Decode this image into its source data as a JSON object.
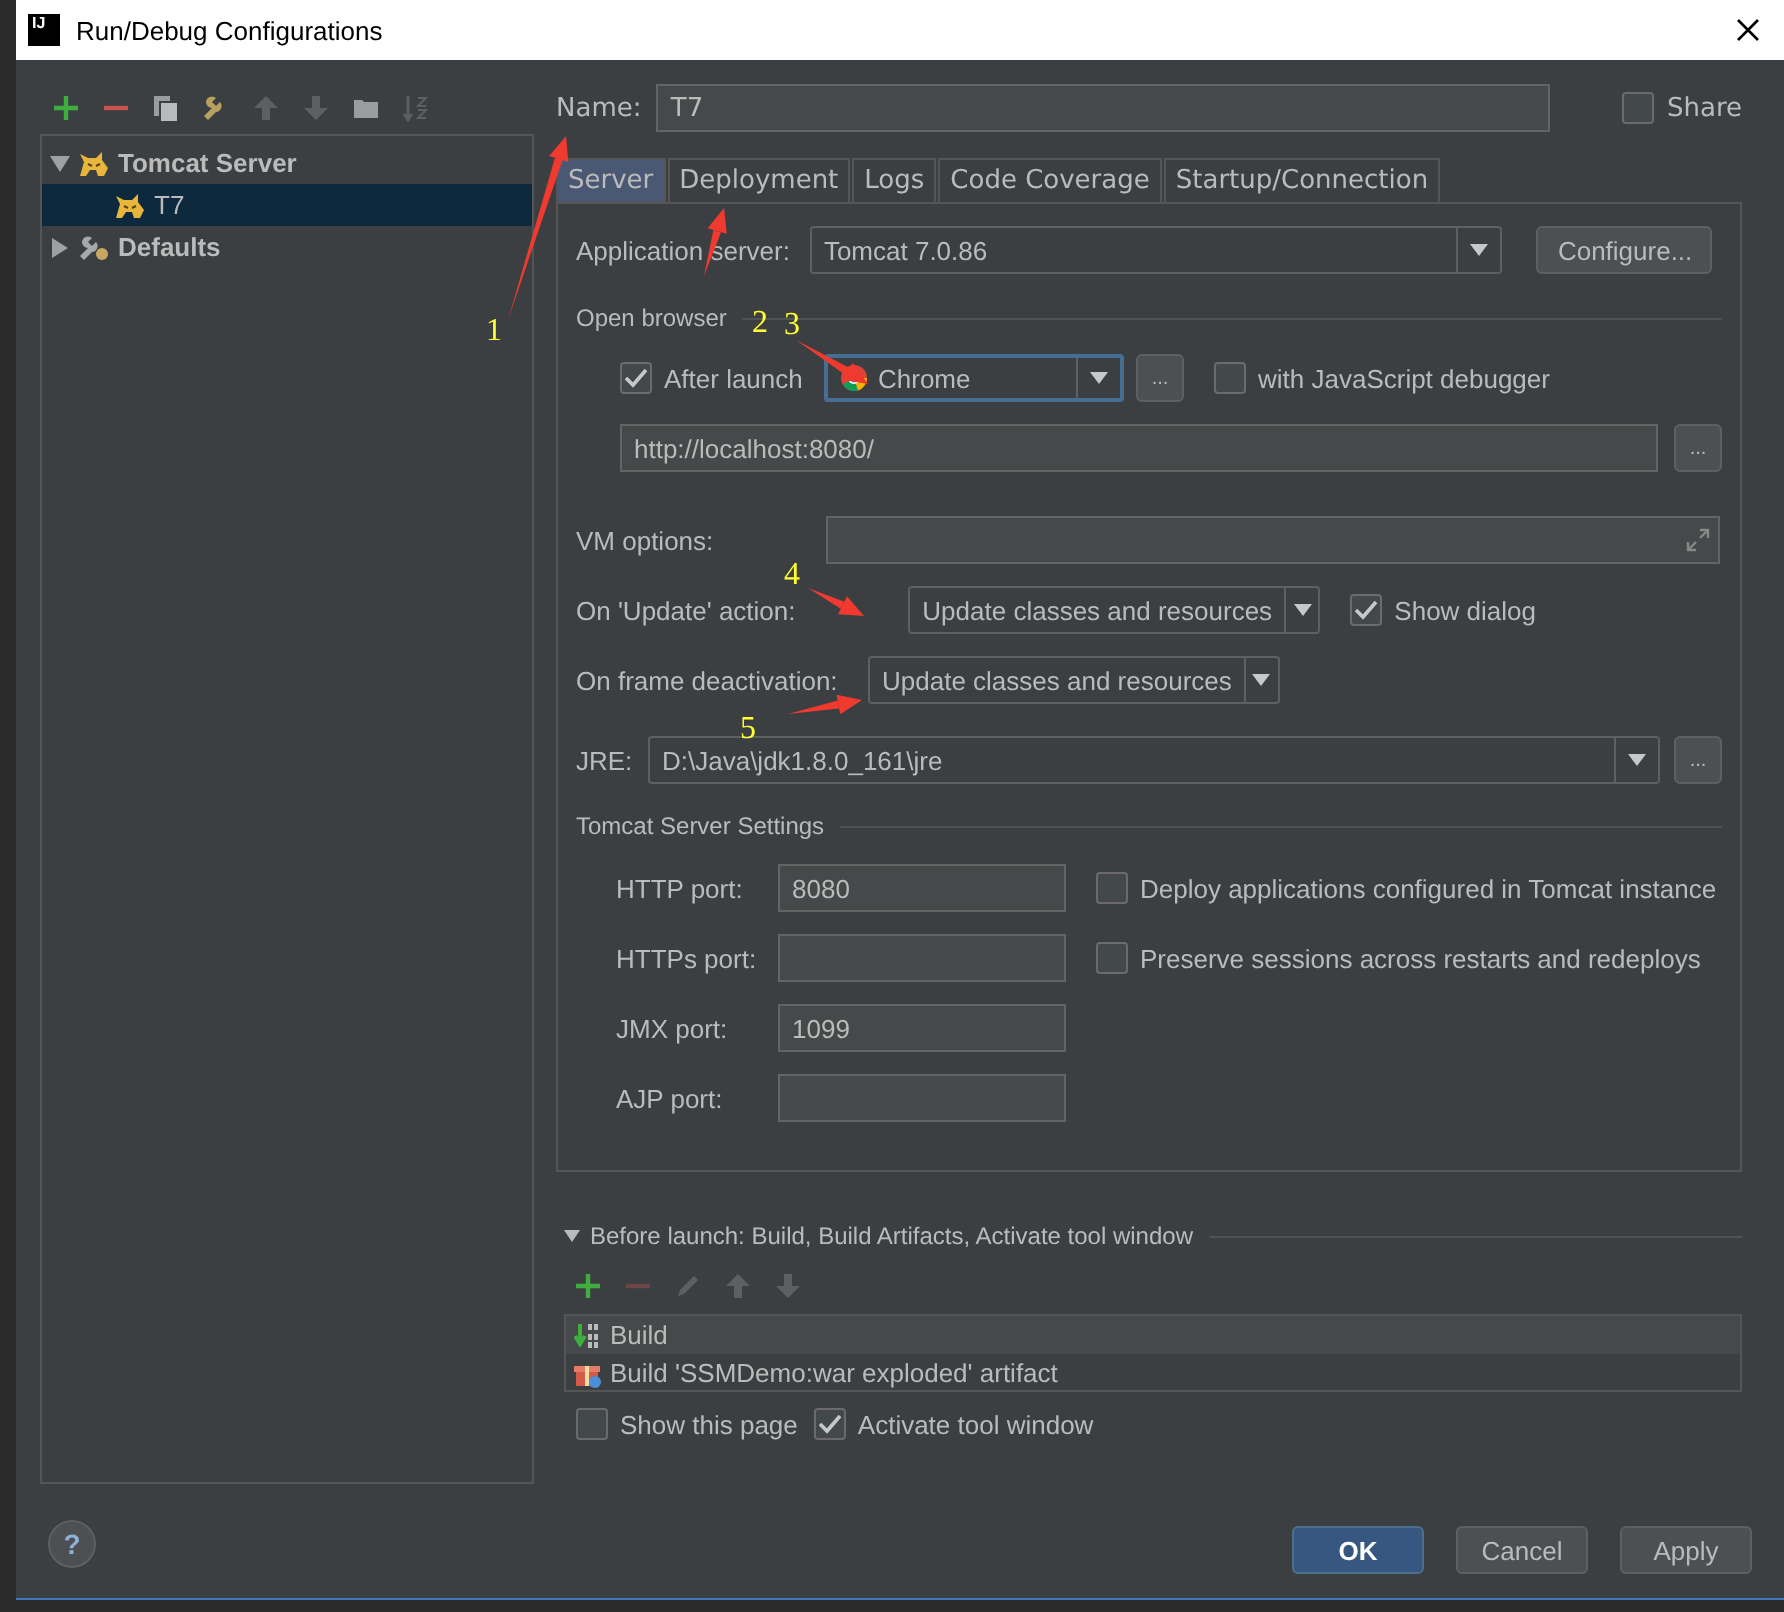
{
  "window": {
    "title": "Run/Debug Configurations",
    "app_icon_text": "IJ"
  },
  "sidebar": {
    "toolbar": [
      {
        "kind": "add",
        "disabled": false
      },
      {
        "kind": "remove",
        "disabled": false
      },
      {
        "kind": "copy",
        "disabled": false
      },
      {
        "kind": "edit-defaults",
        "disabled": false
      },
      {
        "kind": "up",
        "disabled": true
      },
      {
        "kind": "down",
        "disabled": true
      },
      {
        "kind": "folder",
        "disabled": false
      },
      {
        "kind": "sort",
        "disabled": true
      }
    ],
    "tree": [
      {
        "label": "Tomcat Server",
        "kind": "tomcat",
        "expanded": true,
        "selected": false,
        "children": [
          {
            "label": "T7",
            "kind": "tomcat",
            "selected": true
          }
        ]
      },
      {
        "label": "Defaults",
        "kind": "defaults",
        "expanded": false,
        "selected": false
      }
    ]
  },
  "name": {
    "label": "Name:",
    "value": "T7"
  },
  "share": {
    "label": "Share",
    "checked": false
  },
  "tabs": [
    {
      "label": "Server",
      "selected": true
    },
    {
      "label": "Deployment",
      "selected": false
    },
    {
      "label": "Logs",
      "selected": false
    },
    {
      "label": "Code Coverage",
      "selected": false
    },
    {
      "label": "Startup/Connection",
      "selected": false
    }
  ],
  "server": {
    "app_server": {
      "label": "Application server:",
      "value": "Tomcat 7.0.86",
      "button": "Configure..."
    },
    "open_browser": {
      "title": "Open browser",
      "after_launch": {
        "label": "After launch",
        "checked": true
      },
      "browser": "Chrome",
      "browser_button": "...",
      "js_debugger": {
        "label": "with JavaScript debugger",
        "checked": false
      },
      "url": "http://localhost:8080/",
      "url_button": "..."
    },
    "vm_options": {
      "label": "VM options:"
    },
    "on_update": {
      "label": "On 'Update' action:",
      "value": "Update classes and resources"
    },
    "show_dialog": {
      "label": "Show dialog",
      "checked": true
    },
    "on_frame": {
      "label": "On frame deactivation:",
      "value": "Update classes and resources"
    },
    "jre": {
      "label": "JRE:",
      "value": "D:\\Java\\jdk1.8.0_161\\jre",
      "button": "..."
    },
    "tomcat_settings": {
      "title": "Tomcat Server Settings",
      "ports": [
        {
          "label": "HTTP port:",
          "value": "8080"
        },
        {
          "label": "HTTPs port:"
        },
        {
          "label": "JMX port:",
          "value": "1099"
        },
        {
          "label": "AJP port:"
        }
      ],
      "options": [
        {
          "label": "Deploy applications configured in Tomcat instance",
          "checked": false
        },
        {
          "label": "Preserve sessions across restarts and redeploys",
          "checked": false
        }
      ]
    }
  },
  "before_launch": {
    "title": "Before launch: Build, Build Artifacts, Activate tool window",
    "expanded": true,
    "toolbar": [
      {
        "kind": "add",
        "disabled": false
      },
      {
        "kind": "remove",
        "disabled": true
      },
      {
        "kind": "edit",
        "disabled": true
      },
      {
        "kind": "up",
        "disabled": true
      },
      {
        "kind": "down",
        "disabled": true
      }
    ],
    "tasks": [
      {
        "kind": "build",
        "label": "Build"
      },
      {
        "kind": "artifact",
        "label": "Build 'SSMDemo:war exploded' artifact"
      }
    ],
    "show_this_page": {
      "label": "Show this page",
      "checked": false
    },
    "activate_tool_window": {
      "label": "Activate tool window",
      "checked": true
    }
  },
  "help_button": "?",
  "buttons": [
    {
      "label": "OK",
      "kind": "primary"
    },
    {
      "label": "Cancel",
      "kind": "normal"
    },
    {
      "label": "Apply",
      "kind": "normal"
    }
  ],
  "annotations": [
    {
      "label": "1"
    },
    {
      "label": "2"
    },
    {
      "label": "3"
    },
    {
      "label": "4"
    },
    {
      "label": "5"
    }
  ]
}
